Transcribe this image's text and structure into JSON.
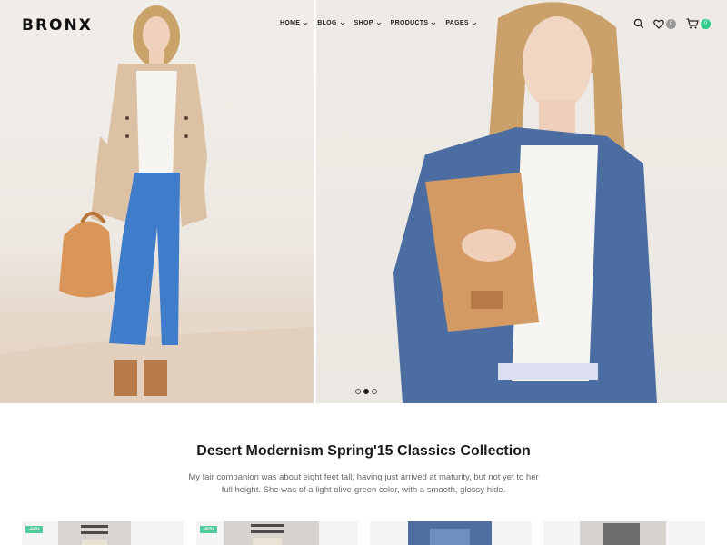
{
  "header": {
    "logo": "BRONX",
    "nav": [
      {
        "label": "HOME"
      },
      {
        "label": "BLOG"
      },
      {
        "label": "SHOP"
      },
      {
        "label": "PRODUCTS"
      },
      {
        "label": "PAGES"
      }
    ],
    "wishlist_count": "0",
    "cart_count": "0"
  },
  "hero": {
    "slides": 3,
    "active_slide": 2
  },
  "collection": {
    "title": "Desert Modernism Spring'15 Classics Collection",
    "description": "My fair companion was about eight feet tall, having just arrived at maturity, but not yet to her full height. She was of a light olive-green color, with a smooth, glossy hide."
  },
  "products": [
    {
      "badge": "-44%"
    },
    {
      "badge": "-40%"
    },
    {
      "badge": ""
    },
    {
      "badge": ""
    }
  ],
  "colors": {
    "accent_green": "#2ecc8f",
    "sale_badge": "#4ecb9b"
  }
}
